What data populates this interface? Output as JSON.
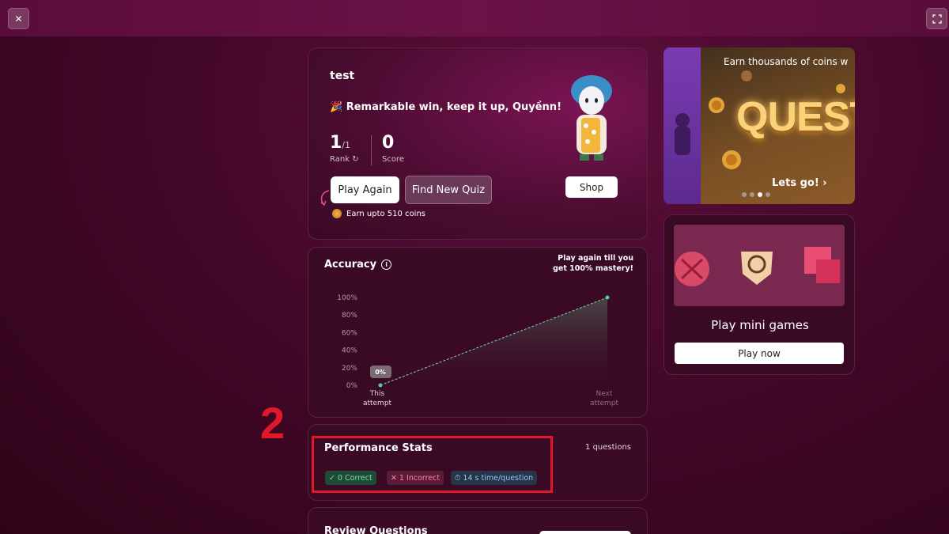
{
  "window": {
    "close_icon": "close-icon",
    "fullscreen_icon": "fullscreen-icon"
  },
  "result": {
    "quiz_title": "test",
    "message": "🎉 Remarkable win, keep it up, Quyềnn!",
    "rank": "1",
    "rank_total": "/1",
    "rank_label": "Rank",
    "score": "0",
    "score_label": "Score",
    "play_again": "Play Again",
    "find_new_quiz": "Find New Quiz",
    "earn_coins": "Earn upto 510 coins",
    "shop": "Shop"
  },
  "accuracy": {
    "title": "Accuracy",
    "note_line1": "Play again till you",
    "note_line2": "get 100% mastery!"
  },
  "chart_data": {
    "type": "line",
    "title": "Accuracy",
    "categories": [
      "This attempt",
      "Next attempt"
    ],
    "values": [
      0,
      100
    ],
    "y_ticks": [
      "100%",
      "80%",
      "60%",
      "40%",
      "20%",
      "0%"
    ],
    "ylim": [
      0,
      100
    ],
    "point_label": "0%",
    "x_labels": [
      [
        "This",
        "attempt"
      ],
      [
        "Next",
        "attempt"
      ]
    ]
  },
  "performance": {
    "title": "Performance Stats",
    "count": "1 questions",
    "correct": "0 Correct",
    "incorrect": "1 Incorrect",
    "time": "14 s time/question",
    "step_number": "2"
  },
  "review": {
    "title": "Review Questions"
  },
  "quests": {
    "earn": "Earn thousands of coins w",
    "word": "QUESTS",
    "cta": "Lets go!",
    "slides": 4,
    "active_slide": 3
  },
  "mini_games": {
    "title": "Play mini games",
    "button": "Play now"
  },
  "colors": {
    "background": "#3f0726",
    "highlight": "#e0182a",
    "correct": "#6fe0a6",
    "incorrect": "#ff7fa5",
    "time": "#8fc8ee"
  }
}
